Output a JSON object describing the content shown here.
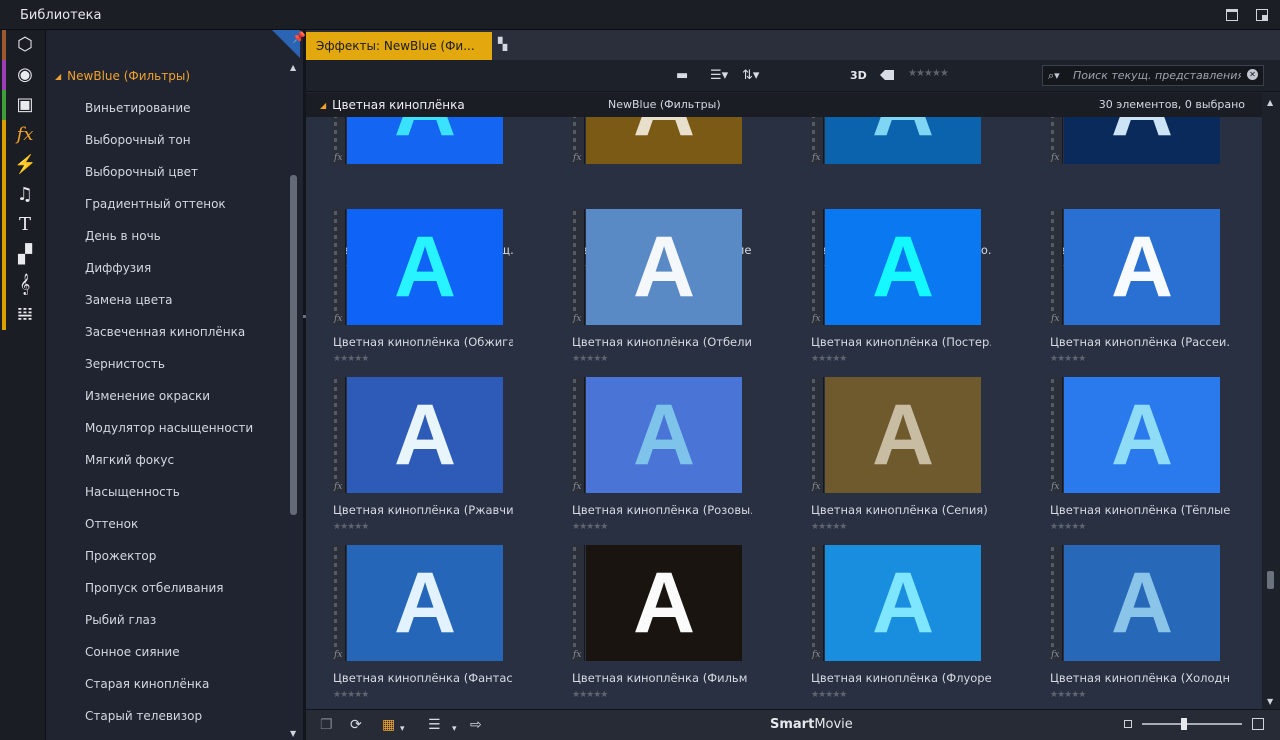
{
  "window": {
    "title": "Библиотека"
  },
  "rail": [
    {
      "icon": "project-bin-icon",
      "glyph": "⬡",
      "color": "#9b5a2e"
    },
    {
      "icon": "film-reel-icon",
      "glyph": "◉",
      "color": "#9b3fb5"
    },
    {
      "icon": "photos-icon",
      "glyph": "▣",
      "color": "#3f9e3a"
    },
    {
      "icon": "fx-effects-icon",
      "glyph": "fx",
      "color": "#d9a000",
      "active": true
    },
    {
      "icon": "transitions-icon",
      "glyph": "⚡",
      "color": "#d9a000"
    },
    {
      "icon": "music-icon",
      "glyph": "♫",
      "color": "#d9a000"
    },
    {
      "icon": "title-icon",
      "glyph": "T",
      "color": "#d9a000"
    },
    {
      "icon": "montage-icon",
      "glyph": "▞",
      "color": "#d9a000"
    },
    {
      "icon": "scorefitter-icon",
      "glyph": "𝄞",
      "color": "#d9a000"
    },
    {
      "icon": "piano-icon",
      "glyph": "𝍐",
      "color": "#d9a000"
    }
  ],
  "tree": {
    "root": "NewBlue (Фильтры)",
    "items": [
      "Виньетирование",
      "Выборочный тон",
      "Выборочный цвет",
      "Градиентный оттенок",
      "День в ночь",
      "Диффузия",
      "Замена цвета",
      "Засвеченная киноплёнка",
      "Зернистость",
      "Изменение окраски",
      "Модулятор насыщенности",
      "Мягкий фокус",
      "Насыщенность",
      "Оттенок",
      "Прожектор",
      "Пропуск отбеливания",
      "Рыбий глаз",
      "Сонное сияние",
      "Старая киноплёнка",
      "Старый телевизор"
    ]
  },
  "tab": {
    "label": "Эффекты: NewBlue (Фи..."
  },
  "toolbar": {
    "label_3d": "3D",
    "rating": "★★★★★",
    "search_placeholder": "Поиск текущ. представления"
  },
  "header": {
    "section": "Цветная киноплёнка",
    "path": "NewBlue (Фильтры)",
    "count": "30 элементов, 0 выбрано"
  },
  "grid": {
    "rating": "★★★★★",
    "rows": [
      [
        {
          "name": "Цветная киноплёнка (Насыщ...",
          "bg": "#1466f2",
          "fg": "#3ae2ff"
        },
        {
          "name": "Цветная киноплёнка (Натрие...",
          "bg": "#7a5a14",
          "fg": "#e8e0cc"
        },
        {
          "name": "Цветная киноплёнка (Невзго...",
          "bg": "#0b63ad",
          "fg": "#7fd6f4"
        },
        {
          "name": "Цветная киноплёнка (Ночь)",
          "bg": "#0b2a5c",
          "fg": "#cde4f6"
        }
      ],
      [
        {
          "name": "Цветная киноплёнка (Обжига...",
          "bg": "#0f63f6",
          "fg": "#27f4ff"
        },
        {
          "name": "Цветная киноплёнка (Отбели...",
          "bg": "#5a8ac6",
          "fg": "#f4f8fb"
        },
        {
          "name": "Цветная киноплёнка (Постер...",
          "bg": "#0a78f0",
          "fg": "#14f8ff"
        },
        {
          "name": "Цветная киноплёнка (Рассеи...",
          "bg": "#2a6fd2",
          "fg": "#f7fbff"
        }
      ],
      [
        {
          "name": "Цветная киноплёнка (Ржавчи...",
          "bg": "#2f5bb8",
          "fg": "#e8f6fb"
        },
        {
          "name": "Цветная киноплёнка (Розовы...",
          "bg": "#4a74d6",
          "fg": "#7ec4ea"
        },
        {
          "name": "Цветная киноплёнка (Сепия)",
          "bg": "#6f5a2e",
          "fg": "#c8bca2"
        },
        {
          "name": "Цветная киноплёнка (Тёплые...",
          "bg": "#2a7aee",
          "fg": "#8fdcf6"
        }
      ],
      [
        {
          "name": "Цветная киноплёнка (Фантас...",
          "bg": "#2666b8",
          "fg": "#e2f2ff"
        },
        {
          "name": "Цветная киноплёнка (Фильм ...",
          "bg": "#1a1410",
          "fg": "#fbfbfb"
        },
        {
          "name": "Цветная киноплёнка (Флуоре...",
          "bg": "#1a8ede",
          "fg": "#7fe6ff"
        },
        {
          "name": "Цветная киноплёнка (Холодн...",
          "bg": "#2768b8",
          "fg": "#8ac4e8"
        }
      ]
    ]
  },
  "bottombar": {
    "brand_bold": "Smart",
    "brand_rest": "Movie",
    "zoom_level": 0.42
  }
}
